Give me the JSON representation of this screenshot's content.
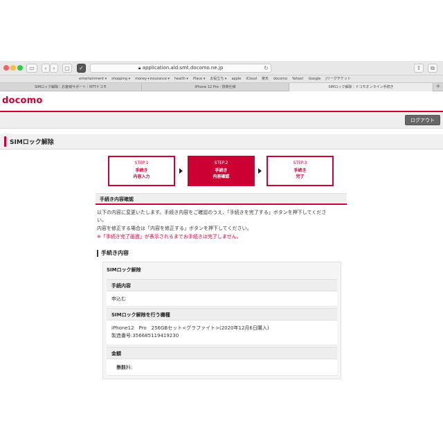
{
  "browser": {
    "url": "application.ald.smt.docomo.ne.jp",
    "bookmarks": [
      "entertainment ▾",
      "shopping ▾",
      "money+insurance ▾",
      "health ▾",
      "Place ▾",
      "お役立ち ▾",
      "apple",
      "iCloud",
      "楽天",
      "docomo",
      "Yahoo!",
      "Google",
      "Jリーグチケット"
    ],
    "tabs": [
      {
        "label": "SIMロック解除｜お客様サポート｜NTTドコモ",
        "active": false
      },
      {
        "label": "iPhone 12 Pro - 技術仕様",
        "active": false
      },
      {
        "label": "SIMロック解除｜ドコモオンライン手続き",
        "active": true
      }
    ]
  },
  "header": {
    "logo": "docomo",
    "logout_label": "ログアウト"
  },
  "page": {
    "title": "SIMロック解除"
  },
  "steps": [
    {
      "label": "STEP.1",
      "line1": "手続き",
      "line2": "内容入力",
      "active": false
    },
    {
      "label": "STEP.2",
      "line1": "手続き",
      "line2": "内容確認",
      "active": true
    },
    {
      "label": "STEP.3",
      "line1": "手続き",
      "line2": "完了",
      "active": false
    }
  ],
  "confirm": {
    "heading": "手続き内容確認",
    "desc_line1": "以下の内容に変更いたします。手続き内容をご確認のうえ、「手続きを完了する」ボタンを押下してくださ",
    "desc_line2": "い。",
    "desc_line3": "内容を修正する場合は「内容を修正する」ボタンを押下してください。",
    "warning": "※「手続き完了画面」が表示されるまでお手続きは完了しません。"
  },
  "details": {
    "heading": "手続き内容",
    "box_title": "SIMロック解除",
    "label_procedure": "手続内容",
    "value_procedure": "申込む",
    "label_device": "SIMロック解除を行う機種",
    "value_device_line1": "iPhone12　Pro　256GBセット<グラファイト>(2020年12月6日購入)",
    "value_device_line2": "製造番号:356685119419230",
    "label_price": "金額",
    "value_price_prefix": "手数料:",
    "value_price": "無料"
  }
}
